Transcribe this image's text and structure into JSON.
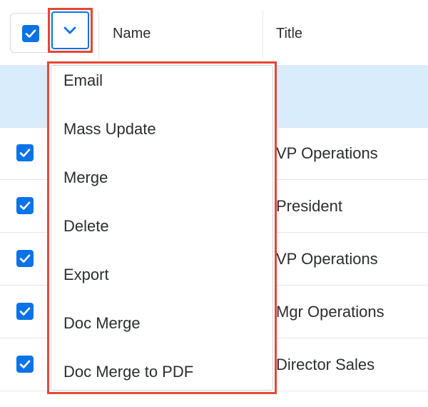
{
  "header": {
    "columns": [
      "Name",
      "Title"
    ]
  },
  "rows": [
    {
      "title": "VP Operations",
      "checked": true
    },
    {
      "title": "President",
      "checked": true
    },
    {
      "title": "VP Operations",
      "checked": true
    },
    {
      "title": "Mgr Operations",
      "checked": true
    },
    {
      "title": "Director Sales",
      "checked": true
    }
  ],
  "menu": {
    "items": [
      "Email",
      "Mass Update",
      "Merge",
      "Delete",
      "Export",
      "Doc Merge",
      "Doc Merge to PDF"
    ]
  },
  "colors": {
    "accent": "#0b72e7",
    "highlight_border": "#e64734",
    "selected_row_bg": "#d9ecfc"
  },
  "icons": {
    "select_all": "checkbox-checked-icon",
    "actions_toggle": "chevron-down-icon"
  }
}
